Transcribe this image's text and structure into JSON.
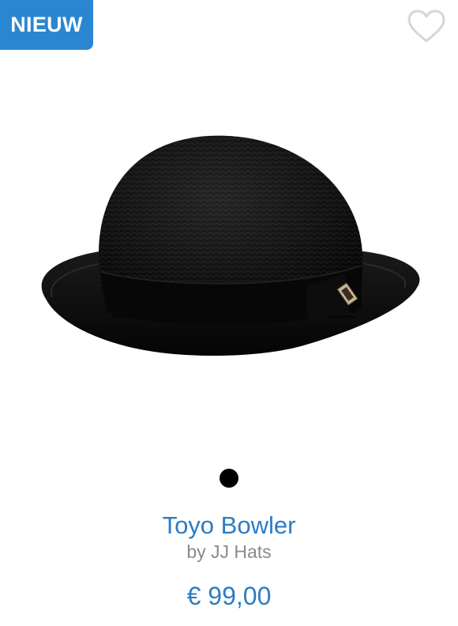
{
  "badge": {
    "label": "NIEUW"
  },
  "favorite": {
    "icon": "heart-outline-icon"
  },
  "product": {
    "image": "black-bowler-hat",
    "title": "Toyo Bowler",
    "brand": "by JJ Hats",
    "price": "€ 99,00"
  },
  "carousel": {
    "dots": 1,
    "active_index": 0
  },
  "colors": {
    "badge_bg": "#2b86d1",
    "accent": "#2b7cc4",
    "muted": "#8a8a8a",
    "heart_outline": "#d6d6d6"
  }
}
